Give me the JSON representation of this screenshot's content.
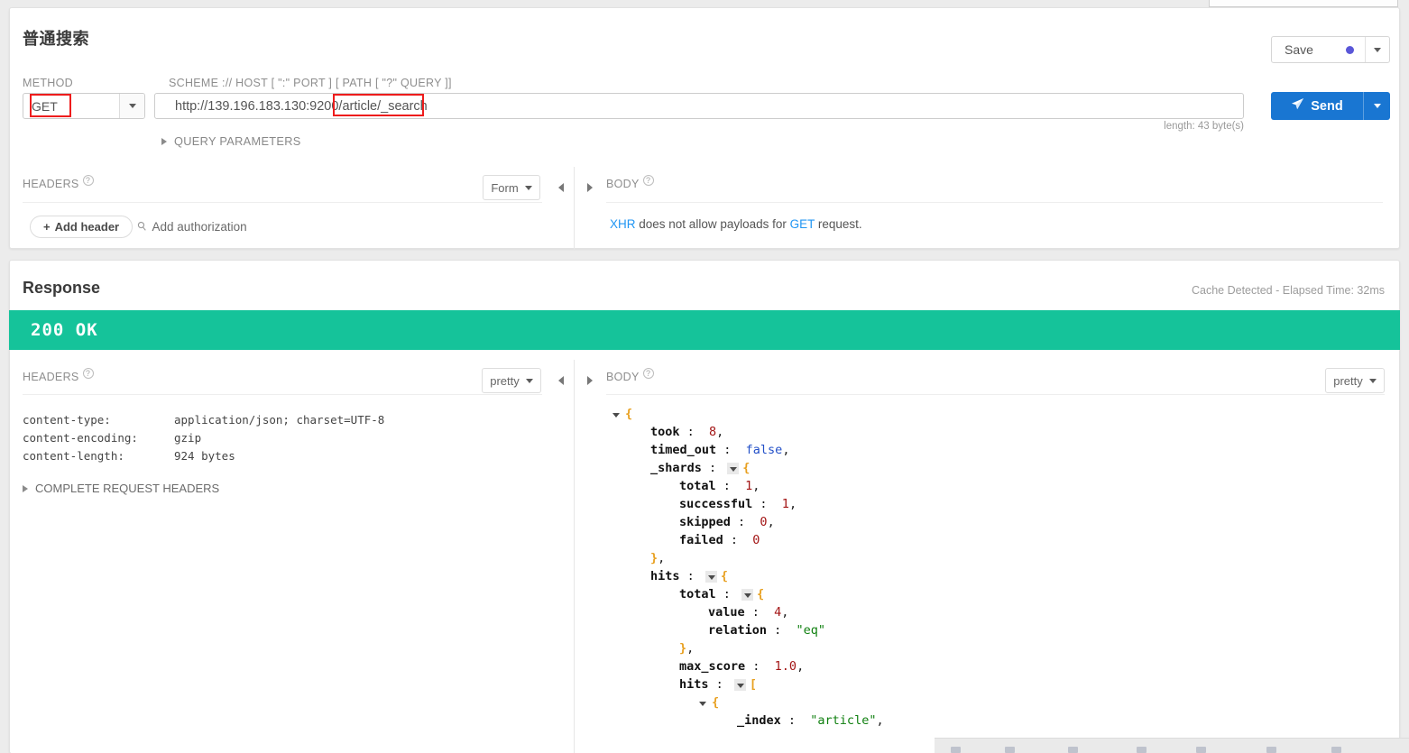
{
  "request": {
    "title": "普通搜索",
    "method_label": "METHOD",
    "method_value": "GET",
    "scheme_label": "SCHEME :// HOST [ \":\" PORT ] [ PATH [ \"?\" QUERY ]]",
    "url_value": "http://139.196.183.130:9200/article/_search",
    "url_host_part": "http://139.196.183.130:9200",
    "url_path_part": "/article/_search",
    "url_length": "length: 43 byte(s)",
    "save_label": "Save",
    "send_label": "Send",
    "query_parameters_label": "QUERY PARAMETERS",
    "headers_label": "HEADERS",
    "headers_format": "Form",
    "add_header_label": "Add header",
    "add_authorization_label": "Add authorization",
    "body_label": "BODY",
    "body_note_prefix": "XHR",
    "body_note_middle": " does not allow payloads for ",
    "body_note_link2": "GET",
    "body_note_suffix": " request."
  },
  "response": {
    "title": "Response",
    "cache_note": "Cache Detected - Elapsed Time: 32ms",
    "status_text": "200 OK",
    "status_color": "#15c39a",
    "headers_label": "HEADERS",
    "headers_format": "pretty",
    "body_label": "BODY",
    "body_format": "pretty",
    "complete_request_headers_label": "COMPLETE REQUEST HEADERS",
    "headers": [
      {
        "key": "content-type:",
        "value": "application/json; charset=UTF-8"
      },
      {
        "key": "content-encoding:",
        "value": "gzip"
      },
      {
        "key": "content-length:",
        "value": "924 bytes"
      }
    ],
    "json_lines": [
      {
        "indent": 0,
        "toggle": "open",
        "tokens": [
          {
            "t": "brace",
            "v": "{"
          }
        ]
      },
      {
        "indent": 1,
        "toggle": "none",
        "tokens": [
          {
            "t": "key",
            "v": "took"
          },
          {
            "t": "plain",
            "v": " :  "
          },
          {
            "t": "num",
            "v": "8"
          },
          {
            "t": "plain",
            "v": ","
          }
        ]
      },
      {
        "indent": 1,
        "toggle": "none",
        "tokens": [
          {
            "t": "key",
            "v": "timed_out"
          },
          {
            "t": "plain",
            "v": " :  "
          },
          {
            "t": "bool",
            "v": "false"
          },
          {
            "t": "plain",
            "v": ","
          }
        ]
      },
      {
        "indent": 1,
        "toggle": "inline",
        "tokens": [
          {
            "t": "key",
            "v": "_shards"
          },
          {
            "t": "plain",
            "v": " : "
          }
        ],
        "after": [
          {
            "t": "brace",
            "v": "{"
          }
        ]
      },
      {
        "indent": 2,
        "toggle": "none",
        "tokens": [
          {
            "t": "key",
            "v": "total"
          },
          {
            "t": "plain",
            "v": " :  "
          },
          {
            "t": "num",
            "v": "1"
          },
          {
            "t": "plain",
            "v": ","
          }
        ]
      },
      {
        "indent": 2,
        "toggle": "none",
        "tokens": [
          {
            "t": "key",
            "v": "successful"
          },
          {
            "t": "plain",
            "v": " :  "
          },
          {
            "t": "num",
            "v": "1"
          },
          {
            "t": "plain",
            "v": ","
          }
        ]
      },
      {
        "indent": 2,
        "toggle": "none",
        "tokens": [
          {
            "t": "key",
            "v": "skipped"
          },
          {
            "t": "plain",
            "v": " :  "
          },
          {
            "t": "num",
            "v": "0"
          },
          {
            "t": "plain",
            "v": ","
          }
        ]
      },
      {
        "indent": 2,
        "toggle": "none",
        "tokens": [
          {
            "t": "key",
            "v": "failed"
          },
          {
            "t": "plain",
            "v": " :  "
          },
          {
            "t": "num",
            "v": "0"
          }
        ]
      },
      {
        "indent": 1,
        "toggle": "none",
        "tokens": [
          {
            "t": "brace",
            "v": "}"
          },
          {
            "t": "plain",
            "v": ","
          }
        ]
      },
      {
        "indent": 1,
        "toggle": "inline",
        "tokens": [
          {
            "t": "key",
            "v": "hits"
          },
          {
            "t": "plain",
            "v": " : "
          }
        ],
        "after": [
          {
            "t": "brace",
            "v": "{"
          }
        ]
      },
      {
        "indent": 2,
        "toggle": "inline",
        "tokens": [
          {
            "t": "key",
            "v": "total"
          },
          {
            "t": "plain",
            "v": " : "
          }
        ],
        "after": [
          {
            "t": "brace",
            "v": "{"
          }
        ]
      },
      {
        "indent": 3,
        "toggle": "none",
        "tokens": [
          {
            "t": "key",
            "v": "value"
          },
          {
            "t": "plain",
            "v": " :  "
          },
          {
            "t": "num",
            "v": "4"
          },
          {
            "t": "plain",
            "v": ","
          }
        ]
      },
      {
        "indent": 3,
        "toggle": "none",
        "tokens": [
          {
            "t": "key",
            "v": "relation"
          },
          {
            "t": "plain",
            "v": " :  "
          },
          {
            "t": "str",
            "v": "\"eq\""
          }
        ]
      },
      {
        "indent": 2,
        "toggle": "none",
        "tokens": [
          {
            "t": "brace",
            "v": "}"
          },
          {
            "t": "plain",
            "v": ","
          }
        ]
      },
      {
        "indent": 2,
        "toggle": "none",
        "tokens": [
          {
            "t": "key",
            "v": "max_score"
          },
          {
            "t": "plain",
            "v": " :  "
          },
          {
            "t": "num",
            "v": "1.0"
          },
          {
            "t": "plain",
            "v": ","
          }
        ]
      },
      {
        "indent": 2,
        "toggle": "inline",
        "tokens": [
          {
            "t": "key",
            "v": "hits"
          },
          {
            "t": "plain",
            "v": " : "
          }
        ],
        "after": [
          {
            "t": "brace",
            "v": "["
          }
        ]
      },
      {
        "indent": 3,
        "toggle": "open",
        "tokens": [],
        "after": [
          {
            "t": "brace",
            "v": "{"
          }
        ]
      },
      {
        "indent": 4,
        "toggle": "none",
        "tokens": [
          {
            "t": "key",
            "v": "_index"
          },
          {
            "t": "plain",
            "v": " :  "
          },
          {
            "t": "str",
            "v": "\"article\""
          },
          {
            "t": "plain",
            "v": ","
          }
        ]
      }
    ]
  },
  "annotations": {
    "highlight_color": "#ee1c1c",
    "boxes": [
      "method-get",
      "url-path"
    ]
  }
}
